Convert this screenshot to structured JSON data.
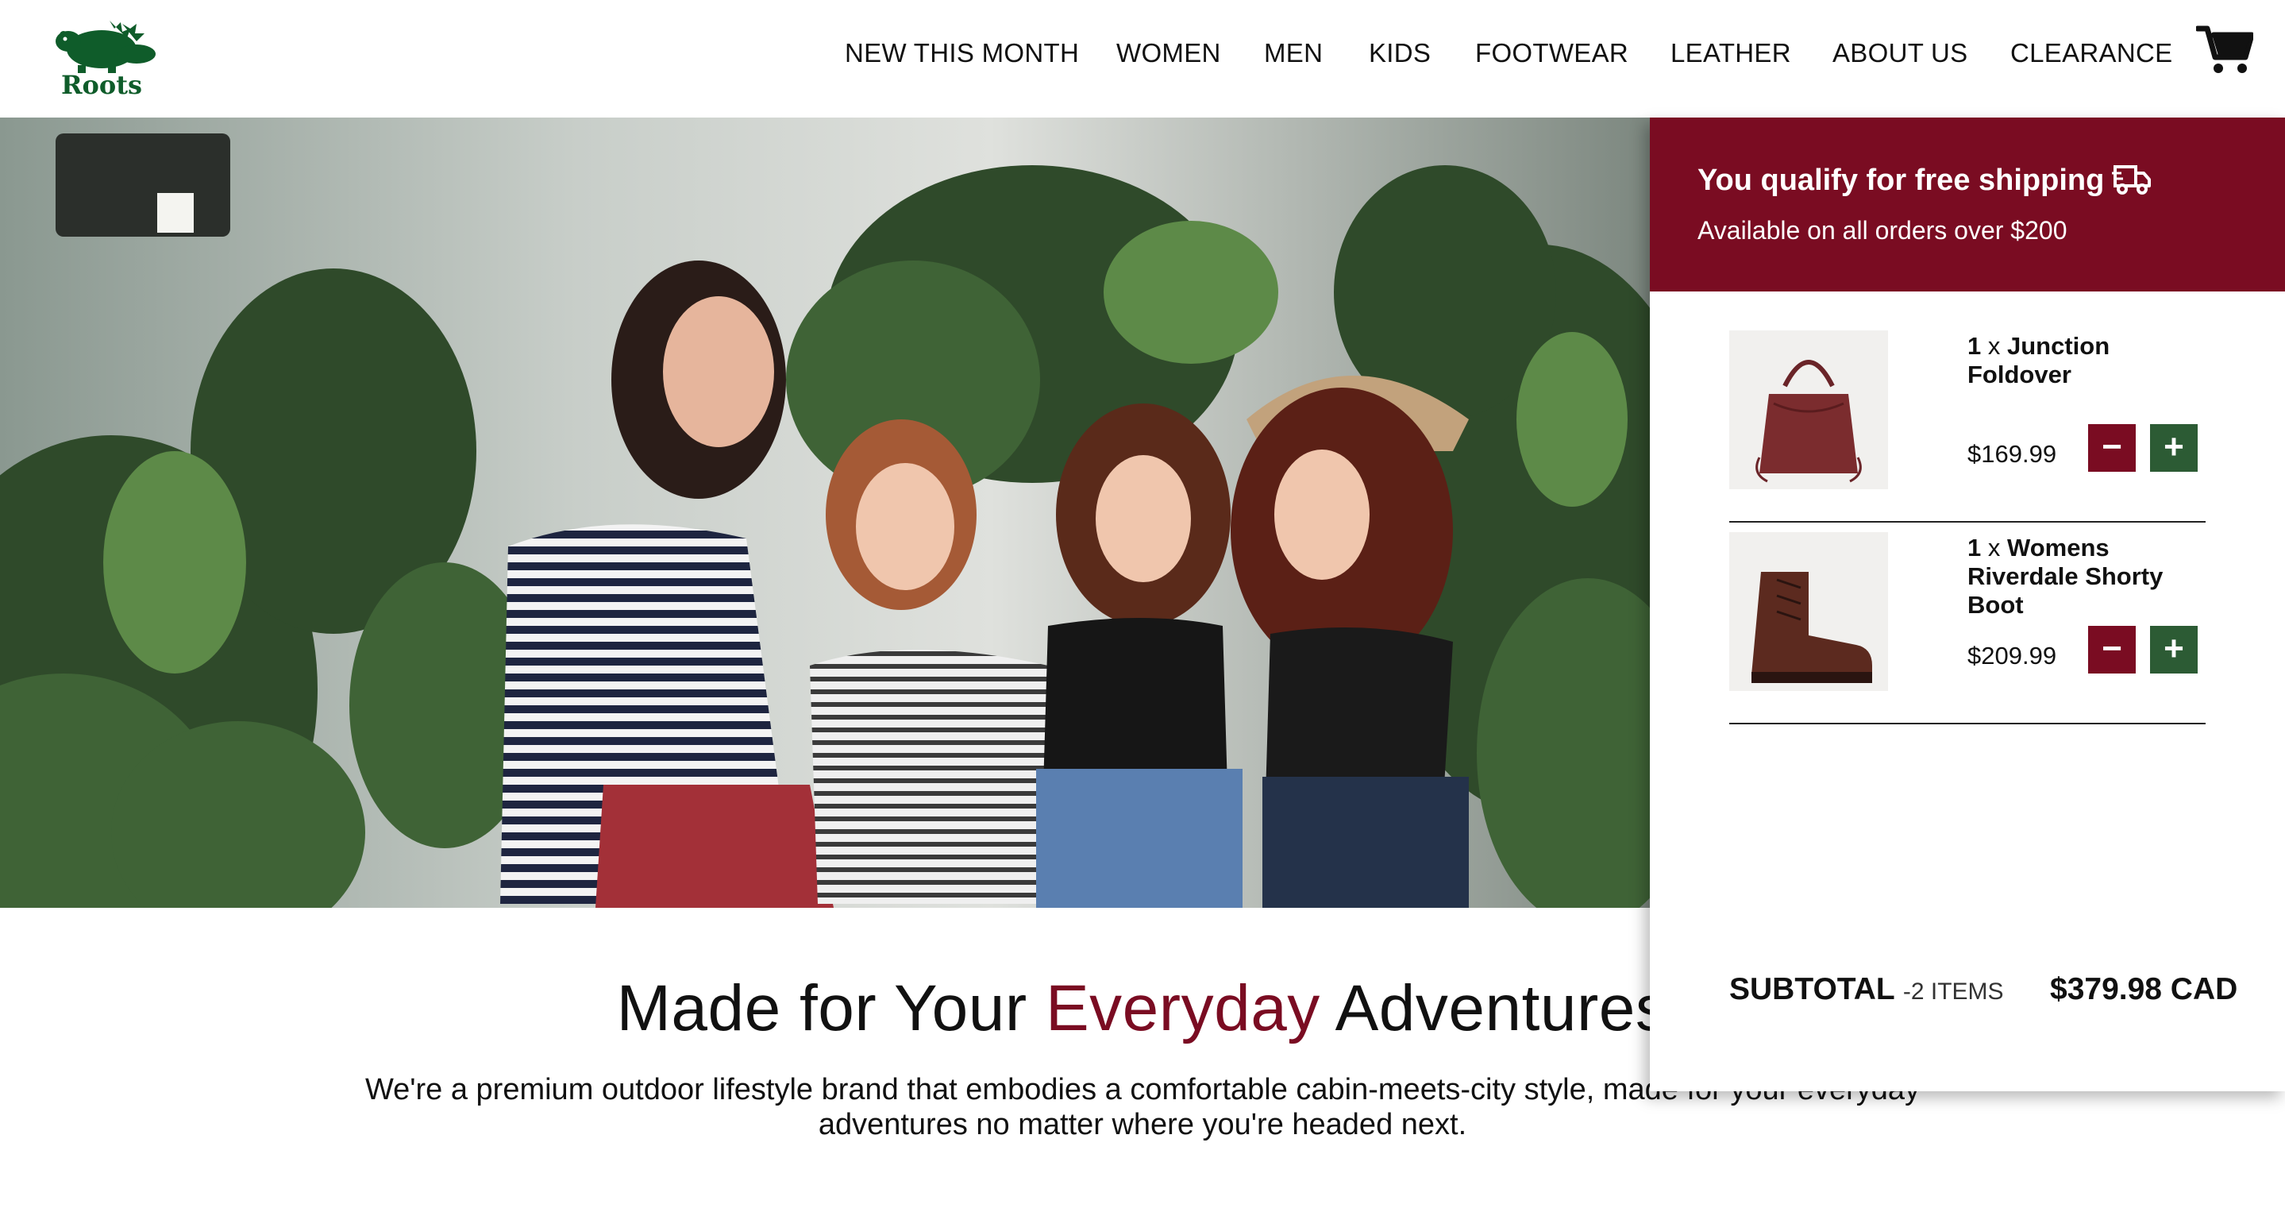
{
  "brand": {
    "logo_text": "Roots"
  },
  "nav": {
    "items": [
      {
        "label": "NEW THIS MONTH"
      },
      {
        "label": "WOMEN"
      },
      {
        "label": "MEN"
      },
      {
        "label": "KIDS"
      },
      {
        "label": "FOOTWEAR"
      },
      {
        "label": "LEATHER"
      },
      {
        "label": "ABOUT US"
      },
      {
        "label": "CLEARANCE"
      }
    ],
    "cart_icon": "shopping-cart-icon"
  },
  "hero": {
    "headline_before": "Made for Your ",
    "headline_accent": "Everyday",
    "headline_after": " Adventures",
    "description": "We're a premium outdoor lifestyle brand that embodies a comfortable cabin-meets-city style, made for your everyday adventures no matter where you're headed next."
  },
  "cart": {
    "shipping_title": "You qualify for free shipping",
    "shipping_icon": "truck-icon",
    "shipping_subtitle": "Available on all orders over $200",
    "items": [
      {
        "qty": "1",
        "times": "x",
        "name": "Junction Foldover",
        "price": "$169.99",
        "minus": "−",
        "plus": "+"
      },
      {
        "qty": "1",
        "times": "x",
        "name": "Womens Riverdale Shorty Boot",
        "price": "$209.99",
        "minus": "−",
        "plus": "+"
      }
    ],
    "subtotal_label": "SUBTOTAL",
    "subtotal_count": "-2 ITEMS",
    "subtotal_value": "$379.98 CAD"
  },
  "colors": {
    "accent": "#7a0c22",
    "brand_green": "#2c5b34",
    "logo_green": "#0f5c2a"
  }
}
